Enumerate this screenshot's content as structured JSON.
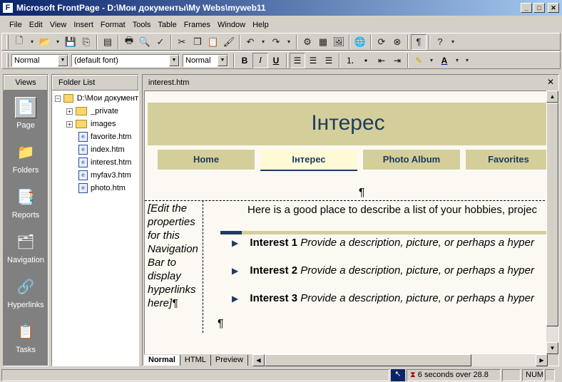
{
  "window": {
    "title": "Microsoft FrontPage - D:\\Мои документы\\My Webs\\myweb11",
    "minimize": "_",
    "maximize": "□",
    "close": "✕"
  },
  "menu": [
    "File",
    "Edit",
    "View",
    "Insert",
    "Format",
    "Tools",
    "Table",
    "Frames",
    "Window",
    "Help"
  ],
  "formatting": {
    "style_value": "Normal",
    "font_value": "(default font)",
    "size_value": "Normal",
    "bold": "B",
    "italic": "I",
    "underline": "U",
    "font_color_label": "A"
  },
  "views": {
    "header": "Views",
    "items": [
      {
        "label": "Page",
        "icon": "page-view-icon",
        "active": true
      },
      {
        "label": "Folders",
        "icon": "folders-view-icon",
        "active": false
      },
      {
        "label": "Reports",
        "icon": "reports-view-icon",
        "active": false
      },
      {
        "label": "Navigation",
        "icon": "navigation-view-icon",
        "active": false
      },
      {
        "label": "Hyperlinks",
        "icon": "hyperlinks-view-icon",
        "active": false
      },
      {
        "label": "Tasks",
        "icon": "tasks-view-icon",
        "active": false
      }
    ]
  },
  "folder_list": {
    "header": "Folder List",
    "root": "D:\\Мои документ",
    "items": [
      {
        "label": "_private",
        "type": "folder"
      },
      {
        "label": "images",
        "type": "folder"
      },
      {
        "label": "favorite.htm",
        "type": "file"
      },
      {
        "label": "index.htm",
        "type": "file"
      },
      {
        "label": "interest.htm",
        "type": "file"
      },
      {
        "label": "myfav3.htm",
        "type": "file"
      },
      {
        "label": "photo.htm",
        "type": "file"
      }
    ]
  },
  "editor": {
    "tab_title": "interest.htm",
    "close": "✕",
    "banner_title": "Інтерес",
    "nav": [
      "Home",
      "Інтерес",
      "Photo Album",
      "Favorites"
    ],
    "pilcrow": "¶",
    "left_cell": "[Edit the properties for this Navigation Bar to display hyperlinks here]",
    "intro": "Here is a good place to describe a list of your hobbies, projec",
    "interests": [
      {
        "name": "Interest 1",
        "desc": "Provide a description, picture, or perhaps a hyper"
      },
      {
        "name": "Interest 2",
        "desc": "Provide a description, picture, or perhaps a hyper"
      },
      {
        "name": "Interest 3",
        "desc": "Provide a description, picture, or perhaps a hyper"
      }
    ],
    "view_tabs": [
      "Normal",
      "HTML",
      "Preview"
    ]
  },
  "status": {
    "download_time": "6 seconds over 28.8",
    "num": "NUM"
  },
  "colors": {
    "title_gradient_start": "#0a246a",
    "banner": "#d4ce9a",
    "banner_text": "#1e3c60",
    "current_nav": "#fffad5"
  }
}
